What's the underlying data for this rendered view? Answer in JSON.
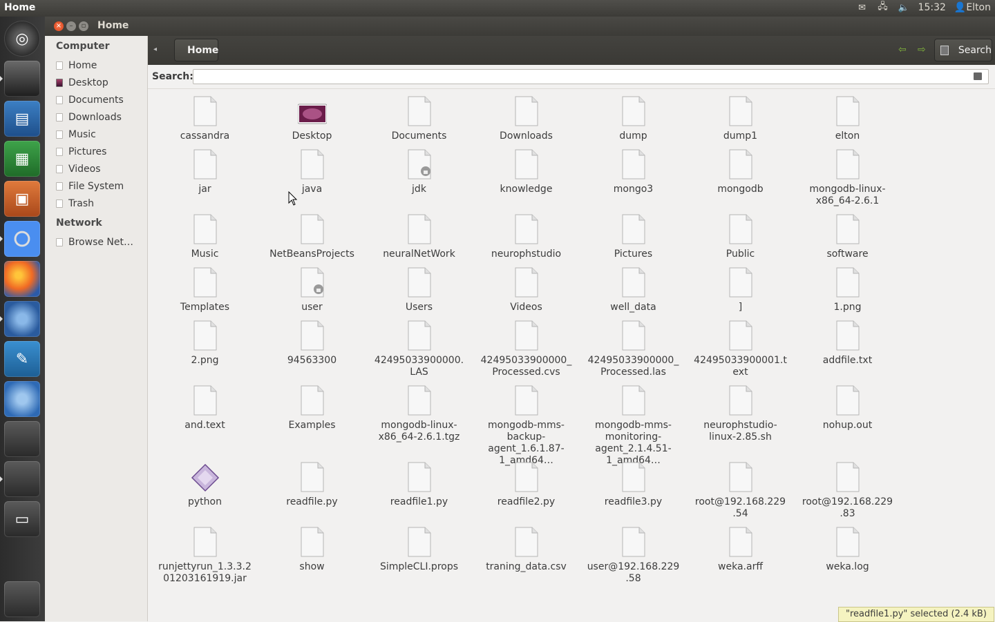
{
  "panel": {
    "app_title": "Home",
    "clock": "15:32",
    "user": "Elton",
    "tray_icons": [
      "mail-icon",
      "network-icon",
      "volume-icon"
    ]
  },
  "window": {
    "title": "Home"
  },
  "sidebar": {
    "computer_heading": "Computer",
    "items": [
      {
        "label": "Home",
        "icon": "folder-icon"
      },
      {
        "label": "Desktop",
        "icon": "desktop-icon"
      },
      {
        "label": "Documents",
        "icon": "folder-icon"
      },
      {
        "label": "Downloads",
        "icon": "folder-icon"
      },
      {
        "label": "Music",
        "icon": "folder-icon"
      },
      {
        "label": "Pictures",
        "icon": "folder-icon"
      },
      {
        "label": "Videos",
        "icon": "folder-icon"
      },
      {
        "label": "File System",
        "icon": "drive-icon"
      },
      {
        "label": "Trash",
        "icon": "trash-icon"
      }
    ],
    "network_heading": "Network",
    "network_items": [
      {
        "label": "Browse Net…",
        "icon": "network-icon"
      }
    ]
  },
  "toolbar": {
    "breadcrumb": "Home",
    "search_label": "Search"
  },
  "searchbar": {
    "label": "Search:",
    "value": ""
  },
  "files": [
    {
      "name": "cassandra"
    },
    {
      "name": "Desktop",
      "type": "desktop"
    },
    {
      "name": "Documents"
    },
    {
      "name": "Downloads"
    },
    {
      "name": "dump"
    },
    {
      "name": "dump1"
    },
    {
      "name": "elton"
    },
    {
      "name": "jar"
    },
    {
      "name": "java"
    },
    {
      "name": "jdk",
      "locked": true
    },
    {
      "name": "knowledge"
    },
    {
      "name": "mongo3"
    },
    {
      "name": "mongodb"
    },
    {
      "name": "mongodb-linux-x86_64-2.6.1"
    },
    {
      "name": "Music"
    },
    {
      "name": "NetBeansProjects"
    },
    {
      "name": "neuralNetWork"
    },
    {
      "name": "neurophstudio"
    },
    {
      "name": "Pictures"
    },
    {
      "name": "Public"
    },
    {
      "name": "software"
    },
    {
      "name": "Templates"
    },
    {
      "name": "user",
      "locked": true
    },
    {
      "name": "Users"
    },
    {
      "name": "Videos"
    },
    {
      "name": "well_data"
    },
    {
      "name": "]"
    },
    {
      "name": "1.png"
    },
    {
      "name": "2.png"
    },
    {
      "name": "94563300"
    },
    {
      "name": "42495033900000.LAS"
    },
    {
      "name": "42495033900000_Processed.cvs"
    },
    {
      "name": "42495033900000_Processed.las"
    },
    {
      "name": "42495033900001.text"
    },
    {
      "name": "addfile.txt"
    },
    {
      "name": "and.text"
    },
    {
      "name": "Examples"
    },
    {
      "name": "mongodb-linux-x86_64-2.6.1.tgz"
    },
    {
      "name": "mongodb-mms-backup-agent_1.6.1.87-1_amd64…"
    },
    {
      "name": "mongodb-mms-monitoring-agent_2.1.4.51-1_amd64…"
    },
    {
      "name": "neurophstudio-linux-2.85.sh"
    },
    {
      "name": "nohup.out"
    },
    {
      "name": "python",
      "type": "python"
    },
    {
      "name": "readfile.py"
    },
    {
      "name": "readfile1.py"
    },
    {
      "name": "readfile2.py"
    },
    {
      "name": "readfile3.py"
    },
    {
      "name": "root@192.168.229.54"
    },
    {
      "name": "root@192.168.229.83"
    },
    {
      "name": "runjettyrun_1.3.3.201203161919.jar"
    },
    {
      "name": "show"
    },
    {
      "name": "SimpleCLI.props"
    },
    {
      "name": "traning_data.csv"
    },
    {
      "name": "user@192.168.229.58"
    },
    {
      "name": "weka.arff"
    },
    {
      "name": "weka.log"
    }
  ],
  "status": "\"readfile1.py\" selected (2.4 kB)",
  "launcher": [
    "dash-icon",
    "workspace-icon",
    "writer-icon",
    "calc-icon",
    "impress-icon",
    "chrome-icon",
    "firefox-icon",
    "thunderbird-icon",
    "workbench-icon",
    "fish-icon",
    "window-icon",
    "window-icon",
    "window-icon",
    "workspace-switcher-icon",
    "trash-launcher-icon"
  ]
}
